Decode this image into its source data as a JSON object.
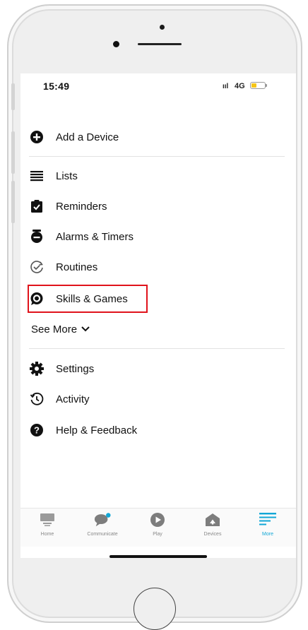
{
  "status_bar": {
    "time": "15:49",
    "signal": "ııl",
    "network": "4G"
  },
  "menu": {
    "add_device": "Add a Device",
    "lists": "Lists",
    "reminders": "Reminders",
    "alarms": "Alarms & Timers",
    "routines": "Routines",
    "skills": "Skills & Games",
    "see_more": "See More",
    "settings": "Settings",
    "activity": "Activity",
    "help": "Help & Feedback"
  },
  "tabbar": {
    "home": "Home",
    "communicate": "Communicate",
    "play": "Play",
    "devices": "Devices",
    "more": "More"
  },
  "colors": {
    "highlight": "#e0131b",
    "accent": "#12a7d6",
    "battery": "#f5c518"
  }
}
